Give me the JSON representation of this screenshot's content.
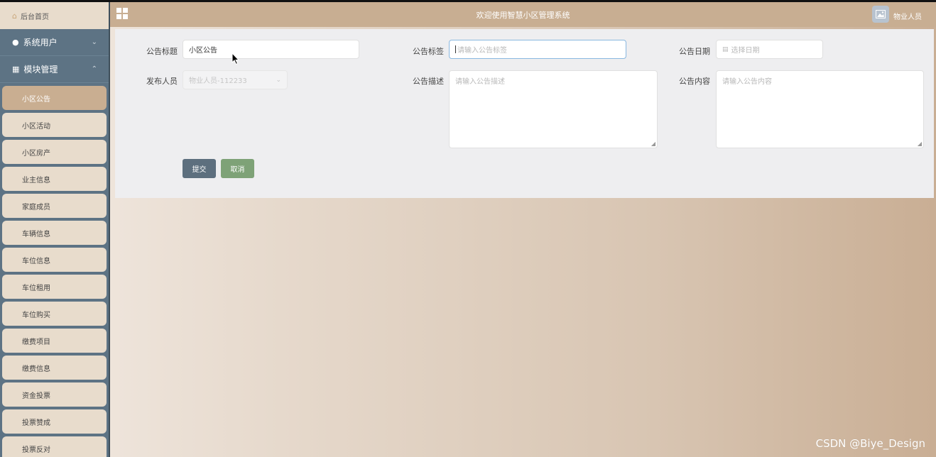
{
  "sidebar": {
    "home": "后台首页",
    "groups": [
      {
        "label": "系统用户",
        "chevron": "⌄"
      },
      {
        "label": "模块管理",
        "chevron": "⌃"
      }
    ],
    "items": [
      "小区公告",
      "小区活动",
      "小区房产",
      "业主信息",
      "家庭成员",
      "车辆信息",
      "车位信息",
      "车位租用",
      "车位购买",
      "缴费项目",
      "缴费信息",
      "资金投票",
      "投票赞成",
      "投票反对"
    ]
  },
  "header": {
    "title": "欢迎使用智慧小区管理系统",
    "user": "物业人员"
  },
  "form": {
    "title_label": "公告标题",
    "title_value": "小区公告",
    "tag_label": "公告标签",
    "tag_placeholder": "请输入公告标签",
    "date_label": "公告日期",
    "date_placeholder": "选择日期",
    "publisher_label": "发布人员",
    "publisher_value": "物业人员-112233",
    "desc_label": "公告描述",
    "desc_placeholder": "请输入公告描述",
    "content_label": "公告内容",
    "content_placeholder": "请输入公告内容",
    "submit": "提交",
    "cancel": "取消"
  },
  "watermark": "CSDN @Biye_Design",
  "colors": {
    "sidebar": "#5d7384",
    "header": "#c8ae92",
    "submit": "#5d6f7e",
    "cancel": "#7ea277"
  }
}
